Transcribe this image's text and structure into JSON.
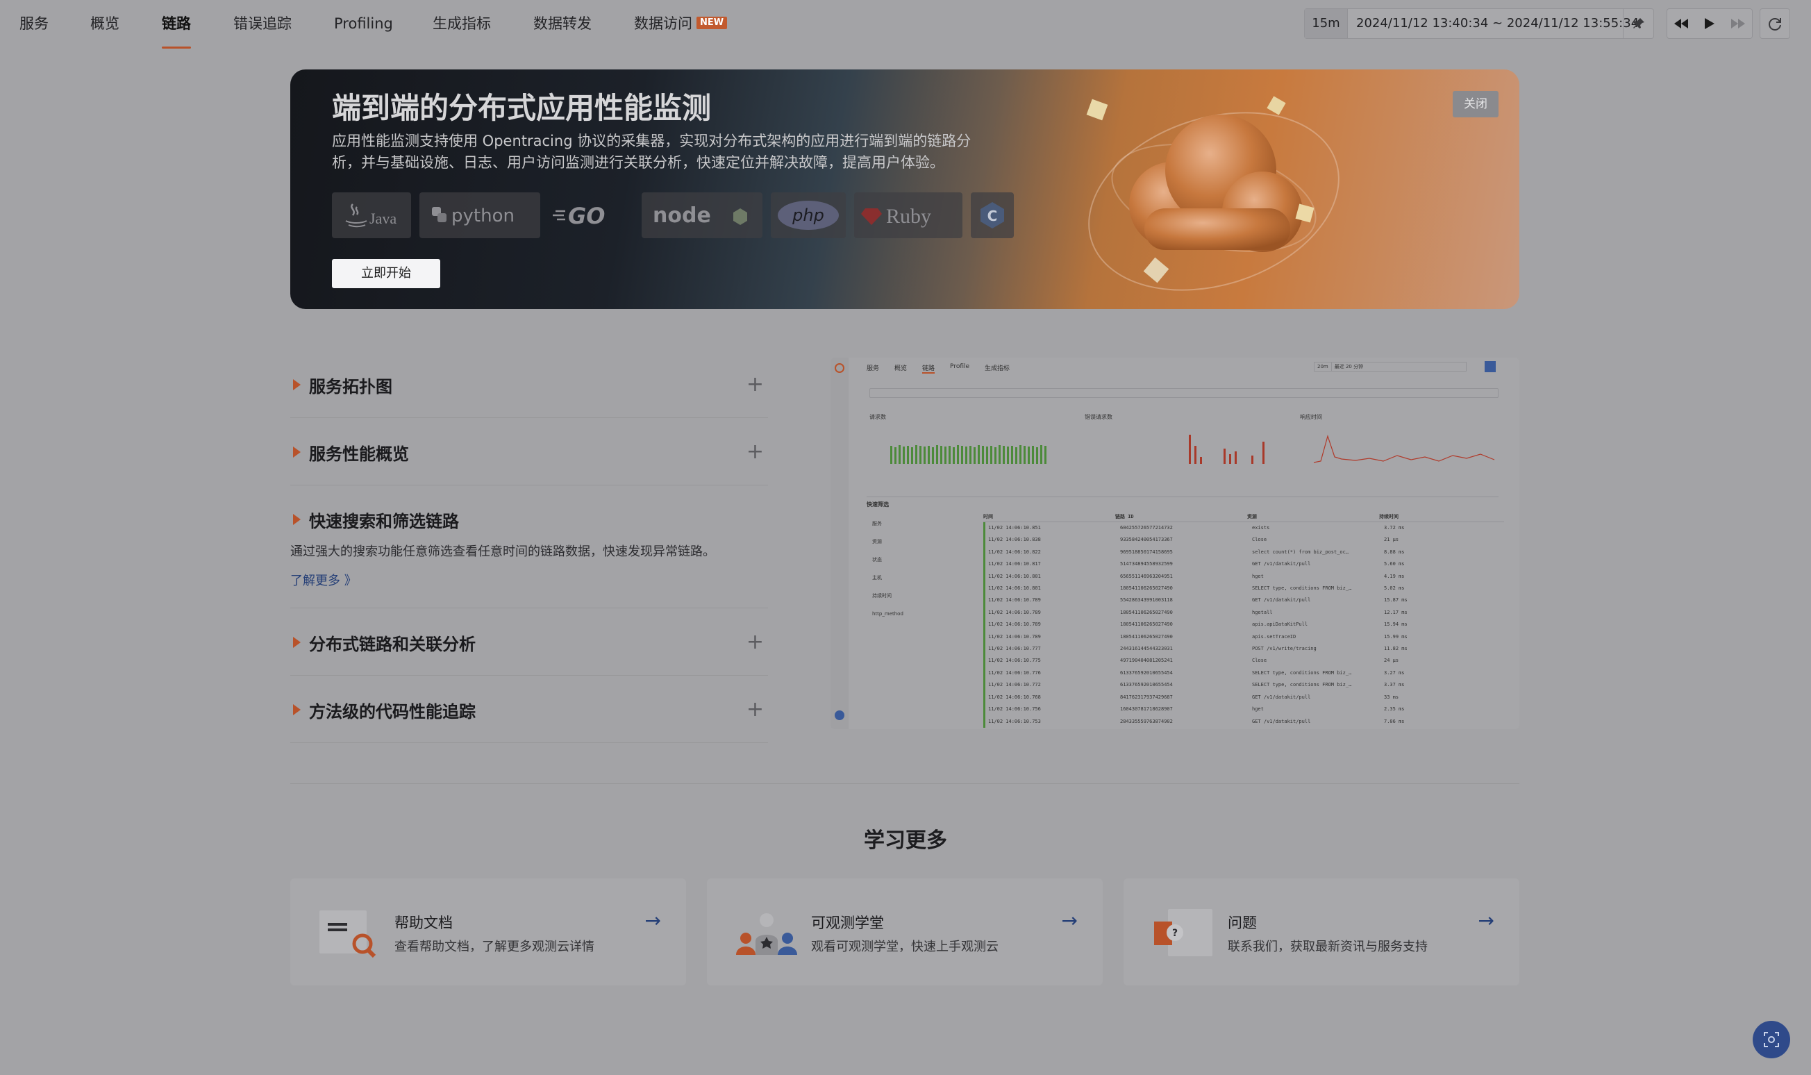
{
  "nav": {
    "tabs": [
      {
        "label": "服务"
      },
      {
        "label": "概览"
      },
      {
        "label": "链路"
      },
      {
        "label": "错误追踪"
      },
      {
        "label": "Profiling"
      },
      {
        "label": "生成指标"
      },
      {
        "label": "数据转发"
      },
      {
        "label": "数据访问"
      }
    ],
    "active_index": 2,
    "new_badge": "NEW"
  },
  "timebar": {
    "quick": "15m",
    "range": "2024/11/12 13:40:34 ~ 2024/11/12 13:55:34"
  },
  "banner": {
    "title": "端到端的分布式应用性能监测",
    "desc": "应用性能监测支持使用 Opentracing 协议的采集器，实现对分布式架构的应用进行端到端的链路分析，并与基础设施、日志、用户访问监测进行关联分析，快速定位并解决故障，提高用户体验。",
    "start_label": "立即开始",
    "close_label": "关闭",
    "logos": [
      {
        "name": "java-logo",
        "text": "Java"
      },
      {
        "name": "python-logo",
        "text": "python"
      },
      {
        "name": "go-logo",
        "text": "GO"
      },
      {
        "name": "nodejs-logo",
        "text": "node"
      },
      {
        "name": "php-logo",
        "text": "php"
      },
      {
        "name": "ruby-logo",
        "text": "Ruby"
      },
      {
        "name": "cpp-logo",
        "text": "C"
      }
    ]
  },
  "features": [
    {
      "title": "服务拓扑图"
    },
    {
      "title": "服务性能概览"
    },
    {
      "title": "快速搜索和筛选链路",
      "desc": "通过强大的搜索功能任意筛选查看任意时间的链路数据，快速发现异常链路。",
      "more": "了解更多 》"
    },
    {
      "title": "分布式链路和关联分析"
    },
    {
      "title": "方法级的代码性能追踪"
    }
  ],
  "preview": {
    "tabs": [
      "服务",
      "概览",
      "链路",
      "Profile",
      "生成指标"
    ],
    "time_quick": "20m",
    "time_range": "最近 20 分钟",
    "chart_titles": [
      "请求数",
      "错误请求数",
      "响应时间"
    ],
    "filters_title": "快速筛选",
    "filter_items": [
      "服务",
      "资源",
      "状态",
      "主机",
      "持续时间",
      "http_method"
    ],
    "table_headers": [
      "时间",
      "链路 ID",
      "资源",
      "持续时间"
    ],
    "rows": [
      [
        "11/02 14:06:10.851",
        "604255726577214732",
        "exists",
        "3.72 ms"
      ],
      [
        "11/02 14:06:10.838",
        "933584240054173367",
        "Close",
        "21 μs"
      ],
      [
        "11/02 14:06:10.822",
        "969518850174158695",
        "select count(*) from biz_post_oc…",
        "8.88 ms"
      ],
      [
        "11/02 14:06:10.817",
        "514734894558932599",
        "GET /v1/datakit/pull",
        "5.60 ms"
      ],
      [
        "11/02 14:06:10.801",
        "656551146963204951",
        "hget",
        "4.19 ms"
      ],
      [
        "11/02 14:06:10.801",
        "180541106265027490",
        "SELECT type, conditions FROM biz_…",
        "5.02 ms"
      ],
      [
        "11/02 14:06:10.789",
        "554286343991003118",
        "GET /v1/datakit/pull",
        "15.87 ms"
      ],
      [
        "11/02 14:06:10.789",
        "180541106265027490",
        "hgetall",
        "12.17 ms"
      ],
      [
        "11/02 14:06:10.789",
        "180541106265027490",
        "apis.apiDataKitPull",
        "15.94 ms"
      ],
      [
        "11/02 14:06:10.789",
        "180541106265027490",
        "apis.setTraceID",
        "15.99 ms"
      ],
      [
        "11/02 14:06:10.777",
        "244316144544323031",
        "POST /v1/write/tracing",
        "11.82 ms"
      ],
      [
        "11/02 14:06:10.775",
        "497190404081205241",
        "Close",
        "24 μs"
      ],
      [
        "11/02 14:06:10.776",
        "613376592010655454",
        "SELECT type, conditions FROM biz_…",
        "3.27 ms"
      ],
      [
        "11/02 14:06:10.772",
        "613376592010655454",
        "SELECT type, conditions FROM biz_…",
        "3.37 ms"
      ],
      [
        "11/02 14:06:10.768",
        "841762317937429687",
        "GET /v1/datakit/pull",
        "33 ms"
      ],
      [
        "11/02 14:06:10.756",
        "160430781718628907",
        "hget",
        "2.35 ms"
      ],
      [
        "11/02 14:06:10.753",
        "284335559763874902",
        "GET /v1/datakit/pull",
        "7.06 ms"
      ]
    ]
  },
  "learn": {
    "title": "学习更多",
    "cards": [
      {
        "title": "帮助文档",
        "sub": "查看帮助文档，了解更多观测云详情"
      },
      {
        "title": "可观测学堂",
        "sub": "观看可观测学堂，快速上手观测云"
      },
      {
        "title": "问题",
        "sub": "联系我们，获取最新资讯与服务支持"
      }
    ]
  },
  "colors": {
    "accent": "#b8522a",
    "link": "#253f77"
  }
}
